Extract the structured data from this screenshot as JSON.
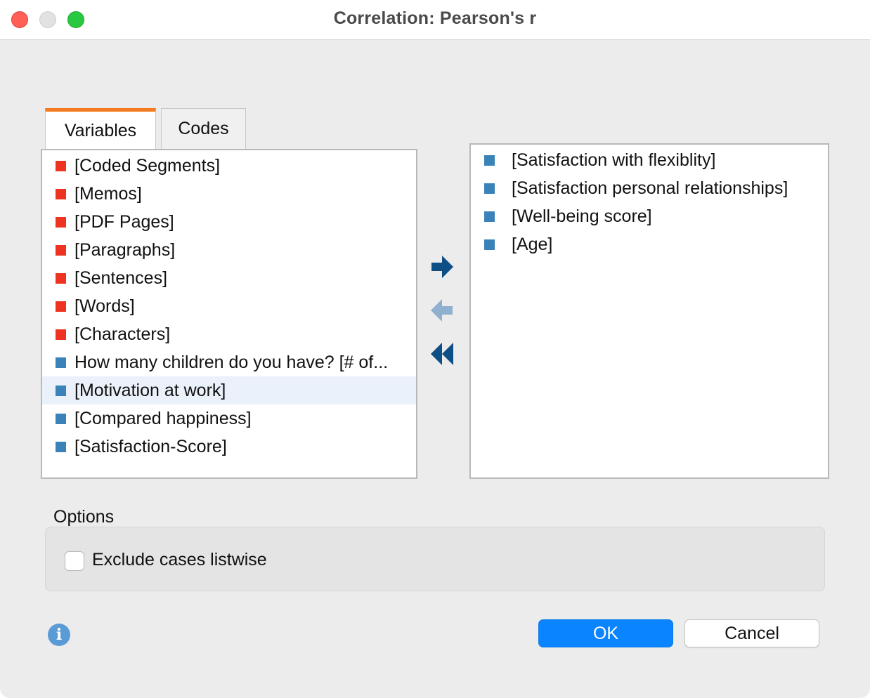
{
  "window": {
    "title": "Correlation: Pearson's r"
  },
  "tabs": [
    {
      "label": "Variables",
      "active": true
    },
    {
      "label": "Codes",
      "active": false
    }
  ],
  "left_list": [
    {
      "label": "[Coded Segments]",
      "color": "#ee3322",
      "selected": false
    },
    {
      "label": "[Memos]",
      "color": "#ee3322",
      "selected": false
    },
    {
      "label": "[PDF Pages]",
      "color": "#ee3322",
      "selected": false
    },
    {
      "label": "[Paragraphs]",
      "color": "#ee3322",
      "selected": false
    },
    {
      "label": "[Sentences]",
      "color": "#ee3322",
      "selected": false
    },
    {
      "label": "[Words]",
      "color": "#ee3322",
      "selected": false
    },
    {
      "label": "[Characters]",
      "color": "#ee3322",
      "selected": false
    },
    {
      "label": "How many children do you have? [# of...",
      "color": "#3b82b8",
      "selected": false
    },
    {
      "label": "[Motivation at work]",
      "color": "#3b82b8",
      "selected": true
    },
    {
      "label": "[Compared happiness]",
      "color": "#3b82b8",
      "selected": false
    },
    {
      "label": "[Satisfaction-Score]",
      "color": "#3b82b8",
      "selected": false
    }
  ],
  "right_list": [
    {
      "label": "[Satisfaction with flexiblity]",
      "color": "#3b82b8"
    },
    {
      "label": "[Satisfaction personal relationships]",
      "color": "#3b82b8"
    },
    {
      "label": "[Well-being score]",
      "color": "#3b82b8"
    },
    {
      "label": "[Age]",
      "color": "#3b82b8"
    }
  ],
  "transfer_buttons": [
    {
      "icon": "arrow-right-icon",
      "enabled": true
    },
    {
      "icon": "arrow-left-icon",
      "enabled": false
    },
    {
      "icon": "double-chevron-left-icon",
      "enabled": true
    }
  ],
  "options": {
    "title": "Options",
    "exclude_listwise": {
      "label": "Exclude cases listwise",
      "checked": false
    }
  },
  "buttons": {
    "ok": "OK",
    "cancel": "Cancel"
  },
  "colors": {
    "accent": "#0a84ff",
    "tab_active": "#f47b20",
    "system_var": "#ee3322",
    "user_var": "#3b82b8"
  }
}
